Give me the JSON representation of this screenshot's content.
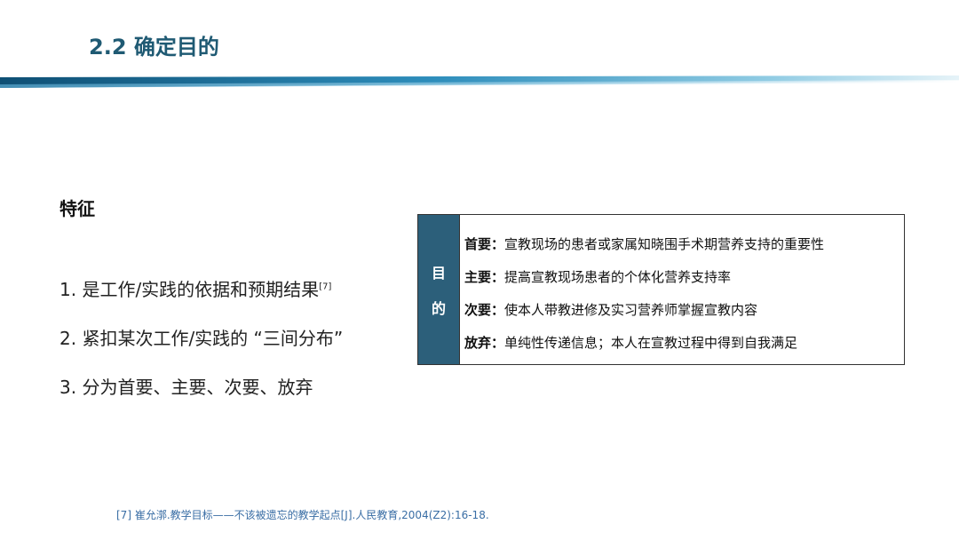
{
  "slide": {
    "title": "2.2 确定目的"
  },
  "features": {
    "heading": "特征",
    "items": [
      {
        "text": "1. 是工作/实践的依据和预期结果",
        "ref": "[7]"
      },
      {
        "text": "2. 紧扣某次工作/实践的 “三间分布”",
        "ref": ""
      },
      {
        "text": "3. 分为首要、主要、次要、放弃",
        "ref": ""
      }
    ]
  },
  "purpose_box": {
    "side_label": [
      "目",
      "的"
    ],
    "rows": [
      {
        "label": "首要：",
        "text": "宣教现场的患者或家属知晓围手术期营养支持的重要性"
      },
      {
        "label": "主要：",
        "text": "提高宣教现场患者的个体化营养支持率"
      },
      {
        "label": "次要：",
        "text": "使本人带教进修及实习营养师掌握宣教内容"
      },
      {
        "label": "放弃：",
        "text": "单纯性传递信息；本人在宣教过程中得到自我满足"
      }
    ]
  },
  "footnote": {
    "text": "[7] 崔允漷.教学目标——不该被遗忘的教学起点[J].人民教育,2004(Z2):16-18."
  },
  "colors": {
    "title": "#1f5a73",
    "side_fill": "#2c5f7a",
    "band_dark": "#1d6a8f",
    "band_light": "#bfe0ee",
    "footnote": "#3a6ea5"
  }
}
